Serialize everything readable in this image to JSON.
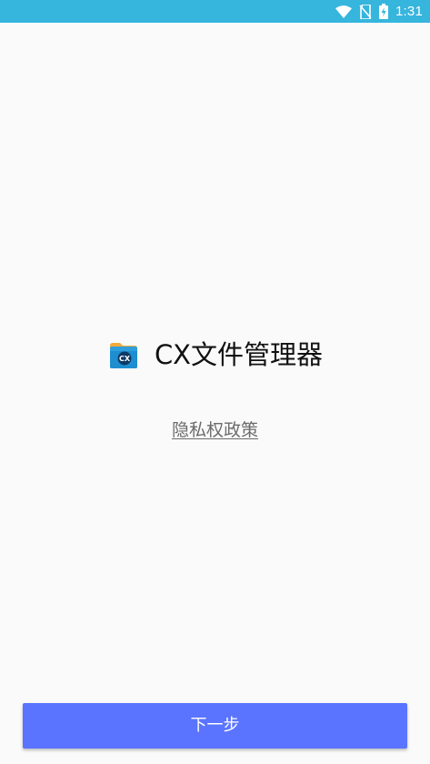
{
  "status_bar": {
    "time": "1:31",
    "background_color": "#36b5dd",
    "icons": [
      "wifi-icon",
      "no-sim-icon",
      "battery-charging-icon"
    ]
  },
  "brand": {
    "icon": "cx-folder-icon",
    "icon_text": "CX",
    "app_name": "CX文件管理器"
  },
  "links": {
    "privacy_policy": "隐私权政策"
  },
  "actions": {
    "next_label": "下一步",
    "next_color": "#5b74ff"
  }
}
